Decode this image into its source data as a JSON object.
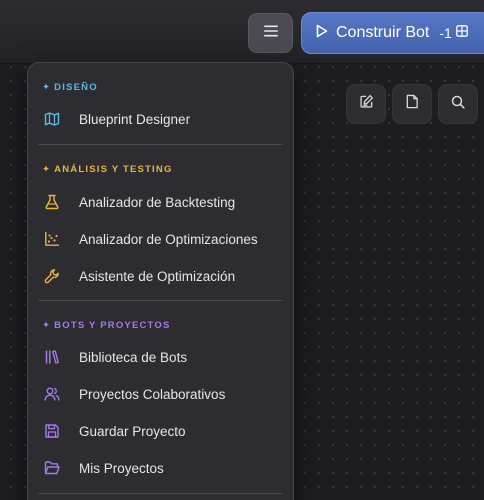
{
  "toolbar": {
    "menu_icon": "hamburger-icon",
    "build_button": {
      "label": "Construir Bot",
      "shortcut": "-1",
      "play_icon": "play-icon",
      "grid_icon": "grid-icon"
    },
    "tools": [
      {
        "icon": "edit-note-icon"
      },
      {
        "icon": "document-icon"
      },
      {
        "icon": "search-icon"
      }
    ]
  },
  "menu": {
    "sections": [
      {
        "title": "DISEÑO",
        "star": "✦",
        "color": "#5bb8e6",
        "items": [
          {
            "label": "Blueprint Designer",
            "icon": "map-icon"
          }
        ]
      },
      {
        "title": "ANÁLISIS Y TESTING",
        "star": "✦",
        "color": "#e2b544",
        "items": [
          {
            "label": "Analizador de Backtesting",
            "icon": "flask-icon"
          },
          {
            "label": "Analizador de Optimizaciones",
            "icon": "scatter-chart-icon"
          },
          {
            "label": "Asistente de Optimización",
            "icon": "wrench-icon"
          }
        ]
      },
      {
        "title": "BOTS Y PROYECTOS",
        "star": "✦",
        "color": "#a57be6",
        "items": [
          {
            "label": "Biblioteca de Bots",
            "icon": "library-icon"
          },
          {
            "label": "Proyectos Colaborativos",
            "icon": "users-icon"
          },
          {
            "label": "Guardar Proyecto",
            "icon": "save-icon"
          },
          {
            "label": "Mis Proyectos",
            "icon": "folder-open-icon"
          }
        ]
      }
    ]
  }
}
